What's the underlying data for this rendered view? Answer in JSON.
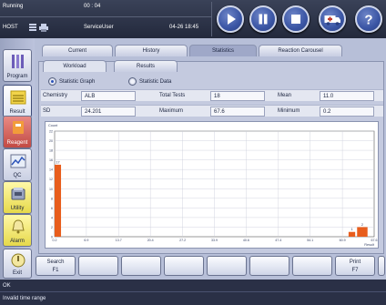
{
  "status": {
    "state": "Running",
    "timer": "00 : 04",
    "host": "HOST",
    "user": "ServiceUser",
    "datetime": "04-26 18:45"
  },
  "controls": [
    {
      "icon": "play-icon"
    },
    {
      "icon": "pause-icon"
    },
    {
      "icon": "stop-icon"
    },
    {
      "icon": "ambulance-icon"
    },
    {
      "icon": "help-icon",
      "label": "?"
    }
  ],
  "sidebar": {
    "items": [
      {
        "label": "Program",
        "icon": "program-icon"
      },
      {
        "label": "Result",
        "icon": "result-icon"
      },
      {
        "label": "Reagent",
        "icon": "reagent-icon"
      },
      {
        "label": "QC",
        "icon": "qc-icon"
      },
      {
        "label": "Utility",
        "icon": "utility-icon"
      },
      {
        "label": "Alarm",
        "icon": "alarm-icon"
      },
      {
        "label": "Exit",
        "icon": "exit-icon"
      }
    ]
  },
  "tabs": [
    "Current",
    "History",
    "Statistics",
    "Reaction Carousel"
  ],
  "subtabs": [
    "Workload",
    "Results"
  ],
  "view_modes": {
    "graph": "Statistic Graph",
    "data": "Statistic Data"
  },
  "stats": {
    "chemistry_label": "Chemistry",
    "chemistry": "ALB",
    "total_tests_label": "Total Tests",
    "total_tests": "18",
    "mean_label": "Mean",
    "mean": "11.0",
    "sd_label": "SD",
    "sd": "24.201",
    "maximum_label": "Maximum",
    "maximum": "67.6",
    "minimum_label": "Minimum",
    "minimum": "0.2"
  },
  "chart_data": {
    "type": "bar",
    "ylabel": "Count",
    "xlabel": "Result",
    "ylim": [
      0,
      22
    ],
    "yticks": [
      "0",
      "2",
      "4",
      "6",
      "8",
      "10",
      "12",
      "14",
      "16",
      "18",
      "20",
      "22"
    ],
    "xticks": [
      "0.2",
      "6.9",
      "13.7",
      "20.4",
      "27.2",
      "33.9",
      "40.6",
      "47.4",
      "54.1",
      "60.9",
      "67.6"
    ],
    "bars": [
      {
        "label": "17",
        "start": 0.2,
        "end": 1.55,
        "value": 15
      },
      {
        "label": "1",
        "start": 62.2,
        "end": 63.6,
        "value": 1
      },
      {
        "label": "2",
        "start": 64.0,
        "end": 66.2,
        "value": 2
      }
    ]
  },
  "fkeys": [
    {
      "label": "Search",
      "key": "F1"
    },
    {
      "label": "",
      "key": ""
    },
    {
      "label": "",
      "key": ""
    },
    {
      "label": "",
      "key": ""
    },
    {
      "label": "",
      "key": ""
    },
    {
      "label": "",
      "key": ""
    },
    {
      "label": "",
      "key": ""
    },
    {
      "label": "Print",
      "key": "F7"
    },
    {
      "label": "",
      "key": ""
    }
  ],
  "messages": {
    "line1": "OK",
    "line2": "Invalid time range"
  },
  "colors": {
    "bar": "#e85d1c",
    "accent": "#2a52b8"
  }
}
